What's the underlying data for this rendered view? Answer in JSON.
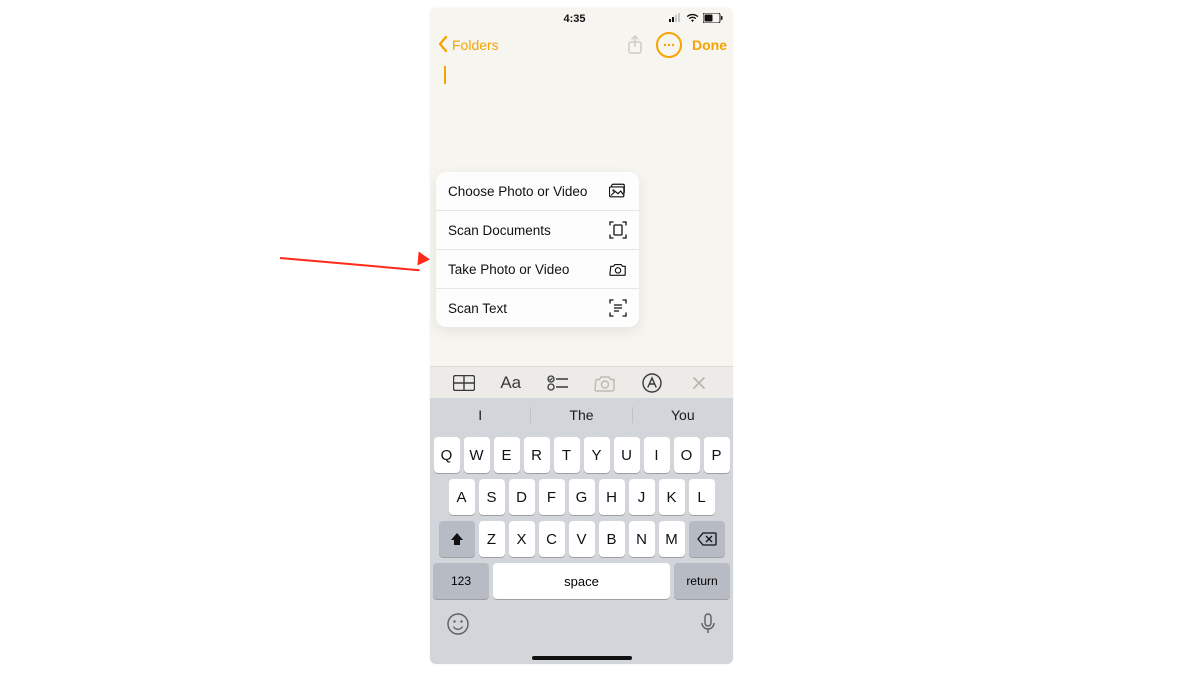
{
  "status": {
    "time": "4:35"
  },
  "nav": {
    "back_label": "Folders",
    "done_label": "Done"
  },
  "menu": {
    "choose_label": "Choose Photo or Video",
    "scan_docs_label": "Scan Documents",
    "take_photo_label": "Take Photo or Video",
    "scan_text_label": "Scan Text"
  },
  "toolbar": {
    "aa": "Aa"
  },
  "suggestions": {
    "s1": "I",
    "s2": "The",
    "s3": "You"
  },
  "keys": {
    "r1": [
      "Q",
      "W",
      "E",
      "R",
      "T",
      "Y",
      "U",
      "I",
      "O",
      "P"
    ],
    "r2": [
      "A",
      "S",
      "D",
      "F",
      "G",
      "H",
      "J",
      "K",
      "L"
    ],
    "r3": [
      "Z",
      "X",
      "C",
      "V",
      "B",
      "N",
      "M"
    ],
    "k123": "123",
    "space": "space",
    "return": "return"
  }
}
